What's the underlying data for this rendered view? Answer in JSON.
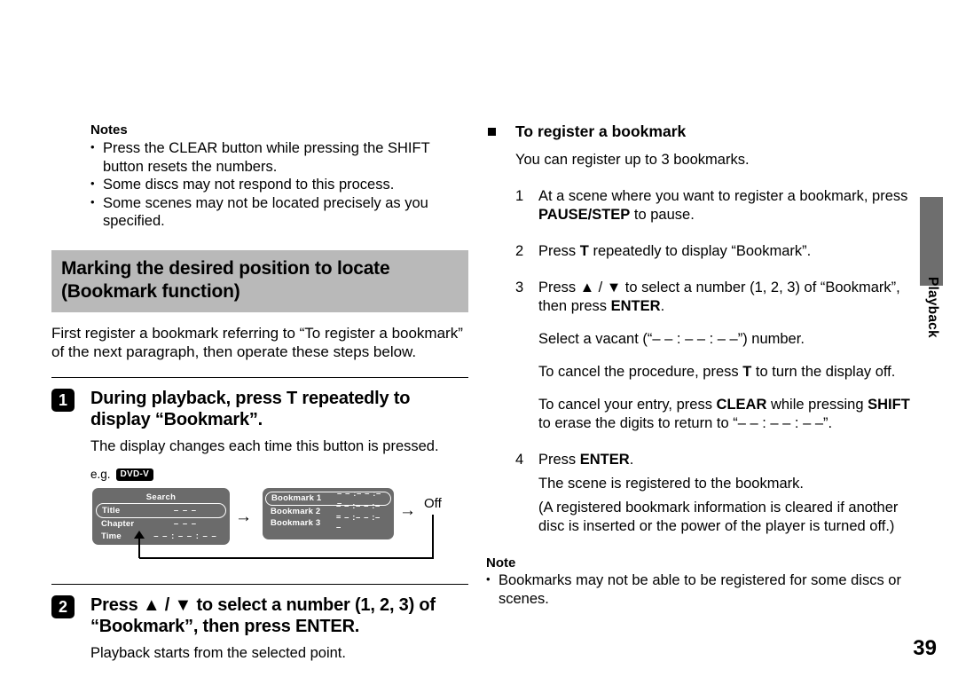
{
  "page": {
    "number": "39",
    "side_tab": "Playback"
  },
  "left": {
    "notes": {
      "title": "Notes",
      "items": [
        "Press the CLEAR button while pressing the SHIFT button resets the numbers.",
        "Some discs may not respond to this process.",
        "Some scenes may not be located precisely as you specified."
      ]
    },
    "section_heading": "Marking the desired position to locate (Bookmark function)",
    "lead": "First register a bookmark referring to “To register a bookmark” of the next paragraph, then operate these steps below.",
    "steps": [
      {
        "number": "1",
        "title": "During playback, press T repeatedly to display “Bookmark”.",
        "desc": "The display changes each time this button is pressed."
      },
      {
        "number": "2",
        "title": "Press ▲ / ▼ to select a number (1, 2, 3) of “Bookmark”, then press ENTER.",
        "desc": "Playback starts from the selected point."
      }
    ],
    "figure": {
      "eg_label": "e.g.",
      "disc_badge": "DVD-V",
      "search_panel": {
        "title": "Search",
        "rows": [
          {
            "label": "Title",
            "value": "– – –",
            "selected": true
          },
          {
            "label": "Chapter",
            "value": "– – –",
            "selected": false
          },
          {
            "label": "Time",
            "value": "– – : – – : – –",
            "selected": false
          }
        ]
      },
      "bookmark_panel": {
        "rows": [
          {
            "label": "Bookmark 1",
            "value": "– – :– – :– –",
            "selected": true
          },
          {
            "label": "Bookmark 2",
            "value": "– – :– – :– –",
            "selected": false
          },
          {
            "label": "Bookmark 3",
            "value": "– – :– – :– –",
            "selected": false
          }
        ]
      },
      "arrow1": "→",
      "arrow2": "→",
      "off_label": "Off"
    }
  },
  "right": {
    "heading": "To register a bookmark",
    "intro": "You can register up to 3 bookmarks.",
    "steps": [
      {
        "number": "1",
        "text_1": "At a scene where you want to register a bookmark, press ",
        "bold_1": "PAUSE/STEP",
        "text_2": " to pause."
      },
      {
        "number": "2",
        "text_1": "Press ",
        "bold_1": "T",
        "text_2": " repeatedly to display “Bookmark”."
      },
      {
        "number": "3",
        "text_1": "Press ▲ / ▼ to select a number (1, 2, 3) of “Bookmark”, then press ",
        "bold_1": "ENTER",
        "text_2": "."
      },
      {
        "number": "4",
        "text_1": "Press ",
        "bold_1": "ENTER",
        "text_2": "."
      }
    ],
    "sub_step3_a": "Select a vacant (“– – : – – : – –”) number.",
    "sub_step3_b_pre": "To cancel the procedure, press ",
    "sub_step3_b_bold": "T",
    "sub_step3_b_post": " to turn the display off.",
    "sub_step3_c_pre": "To cancel your entry, press ",
    "sub_step3_c_bold1": "CLEAR",
    "sub_step3_c_mid": " while pressing ",
    "sub_step3_c_bold2": "SHIFT",
    "sub_step3_c_post": " to erase the digits to return to “– – : – – : – –”.",
    "sub_step4_a": "The scene is registered to the bookmark.",
    "sub_step4_b": "(A registered bookmark information is cleared if another disc is inserted or the power of the player is turned off.)",
    "note": {
      "title": "Note",
      "items": [
        "Bookmarks may not be able to be registered for some discs or scenes."
      ]
    }
  },
  "colors": {
    "heading_bar": "#b9b9b9",
    "osd_panel": "#6b6b6b",
    "side_tab": "#6e6e6e"
  }
}
